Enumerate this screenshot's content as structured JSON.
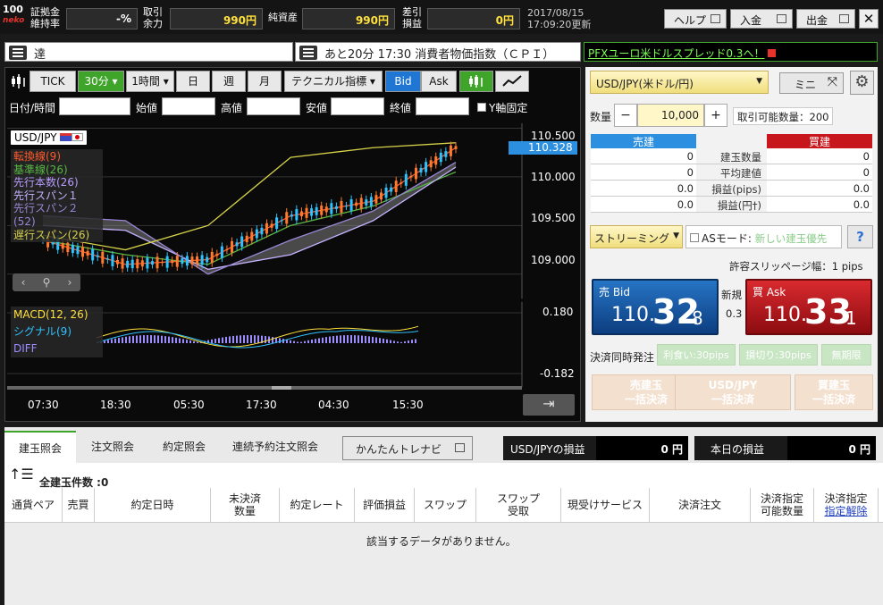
{
  "top": {
    "logo_line1": "100",
    "logo_line2": "neko",
    "margin_label_1": "証拠金",
    "margin_label_2": "維持率",
    "margin_value": "-%",
    "available_label_1": "取引",
    "available_label_2": "余力",
    "available_value": "990円",
    "net_assets_label": "純資産",
    "net_assets_value": "990円",
    "pl_label_1": "差引",
    "pl_label_2": "損益",
    "pl_value": "0円",
    "date": "2017/08/15",
    "updated": "17:09:20更新",
    "help_label": "ヘルプ",
    "deposit_label": "入金",
    "withdraw_label": "出金",
    "close_glyph": "✕"
  },
  "news": {
    "left_text": "達",
    "center_text": "あと20分 17:30 消費者物価指数（ＣＰＩ）",
    "promo_text": "PFXユーロ米ドルスプレッド0.3へ！"
  },
  "chart_toolbar": {
    "tick": "TICK",
    "m30": "30分",
    "h1": "1時間",
    "day": "日",
    "week": "週",
    "month": "月",
    "tech": "テクニカル指標",
    "bid": "Bid",
    "ask": "Ask"
  },
  "ohlc": {
    "datetime": "日付/時間",
    "open": "始値",
    "high": "高値",
    "low": "安値",
    "close": "終値",
    "yfix": "Y軸固定"
  },
  "chart": {
    "pair": "USD/JPY",
    "legend": [
      {
        "label": "転換線(9)",
        "color": "#ff5a2d"
      },
      {
        "label": "基準線(26)",
        "color": "#58b845"
      },
      {
        "label": "先行本数(26)",
        "color": "#b89cff"
      },
      {
        "label": "先行スパン１",
        "color": "#c6b3ff"
      },
      {
        "label": "先行スパン２(52)",
        "color": "#9a86d6"
      },
      {
        "label": "遅行スパン(26)",
        "color": "#d6d24a"
      }
    ],
    "price_ticks": [
      "110.500",
      "110.000",
      "109.500",
      "109.000"
    ],
    "current_price": "110.328",
    "macd_labels": [
      {
        "label": "MACD(12, 26)",
        "color": "#ffe03c"
      },
      {
        "label": "シグナル(9)",
        "color": "#2ec3ff"
      },
      {
        "label": "DIFF",
        "color": "#9b8cff"
      }
    ],
    "macd_ticks": [
      "0.180",
      "-0.182"
    ],
    "time_ticks": [
      "07:30",
      "18:30",
      "05:30",
      "17:30",
      "04:30",
      "15:30"
    ]
  },
  "chart_data": {
    "type": "line",
    "title": "USD/JPY",
    "x": [
      "07:30",
      "18:30",
      "05:30",
      "17:30",
      "04:30",
      "15:30"
    ],
    "ylim": [
      108.75,
      110.55
    ],
    "series": [
      {
        "name": "転換線(9)",
        "values": [
          109.35,
          109.1,
          109.15,
          109.6,
          109.75,
          110.3
        ]
      },
      {
        "name": "基準線(26)",
        "values": [
          109.35,
          109.2,
          109.1,
          109.5,
          109.7,
          110.05
        ]
      },
      {
        "name": "先行スパン１",
        "values": [
          109.5,
          109.45,
          109.05,
          109.2,
          109.55,
          110.1
        ]
      },
      {
        "name": "先行スパン２(52)",
        "values": [
          109.6,
          109.55,
          109.0,
          109.35,
          109.65,
          110.15
        ]
      },
      {
        "name": "遅行スパン(26)",
        "values": [
          109.4,
          109.25,
          109.5,
          110.2,
          110.3,
          110.35
        ]
      }
    ]
  },
  "order": {
    "pair_select": "USD/JPY(米ドル/円)",
    "mini_label": "ミニ",
    "qty_label": "数量",
    "qty_minus": "−",
    "qty_value": "10,000",
    "qty_plus": "+",
    "max_qty": "取引可能数量：200",
    "sell_header": "売建",
    "buy_header": "買建",
    "row_labels": [
      "建玉数量",
      "平均建値",
      "損益(pips)",
      "損益(円†)"
    ],
    "sell_values": [
      "0",
      "0",
      "0.0",
      "0.0"
    ],
    "buy_values": [
      "0",
      "0",
      "0.0",
      "0.0"
    ],
    "stream_label": "ストリーミング",
    "as_mode_label": "ASモード:",
    "as_mode_value": "新しい建玉優先",
    "help_q": "?",
    "slippage": "許容スリッページ幅：1 pips",
    "bid_label": "売 Bid",
    "bid_int": "110.",
    "bid_big": "32",
    "bid_small": "8",
    "new_label": "新規",
    "spread": "0.3",
    "ask_label": "買 Ask",
    "ask_int": "110.",
    "ask_big": "33",
    "ask_small": "1",
    "settle_label": "決済同時発注",
    "take_profit": "利食い:30pips",
    "stop_loss": "損切り:30pips",
    "unlimited": "無期限",
    "bulk_sell_1": "売建玉",
    "bulk_sell_2": "一括決済",
    "bulk_pair_1": "USD/JPY",
    "bulk_pair_2": "一括決済",
    "bulk_buy_1": "買建玉",
    "bulk_buy_2": "一括決済"
  },
  "bottom": {
    "tabs": [
      "建玉照会",
      "注文照会",
      "約定照会",
      "連続予約注文照会"
    ],
    "easy_label": "かんたんトレナビ",
    "pair_pl_label": "USD/JPYの損益",
    "pair_pl_value": "0 円",
    "today_pl_label": "本日の損益",
    "today_pl_value": "0 円",
    "total_count": "全建玉件数 :0",
    "columns": [
      "通貨ペア",
      "売買",
      "約定日時",
      "未決済\n数量",
      "約定レート",
      "評価損益",
      "スワップ",
      "スワップ\n受取",
      "現受けサービス",
      "決済注文",
      "決済指定\n可能数量",
      "決済指定\n指定解除"
    ],
    "empty_message": "該当するデータがありません。"
  }
}
